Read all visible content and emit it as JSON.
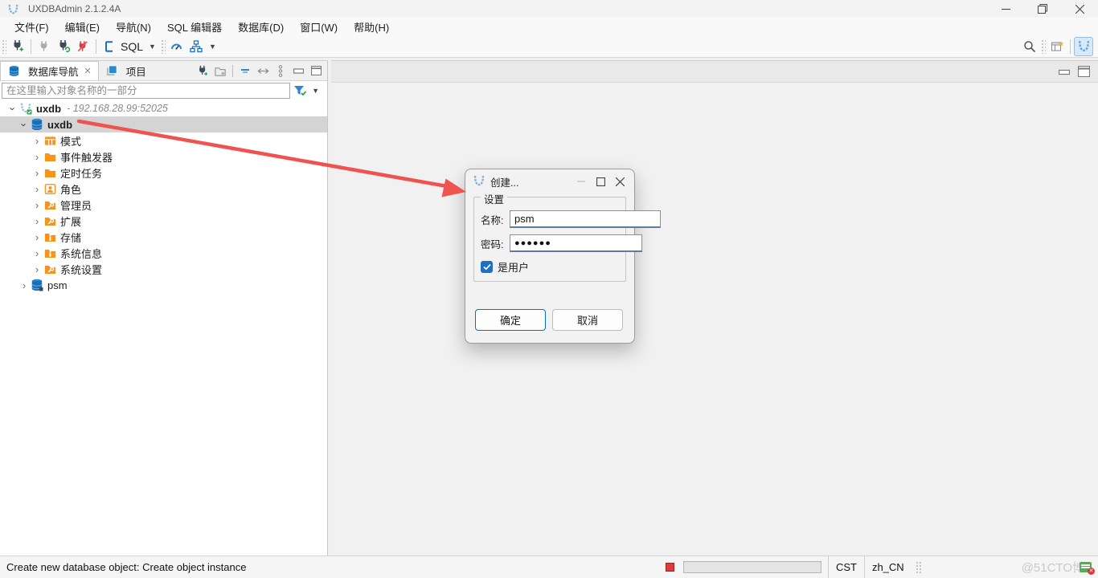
{
  "window": {
    "title": "UXDBAdmin 2.1.2.4A"
  },
  "menu": {
    "items": [
      "文件(F)",
      "编辑(E)",
      "导航(N)",
      "SQL 编辑器",
      "数据库(D)",
      "窗口(W)",
      "帮助(H)"
    ]
  },
  "toolbar": {
    "sql_label": "SQL"
  },
  "navigator": {
    "tab_database": "数据库导航",
    "tab_projects": "项目",
    "filter_placeholder": "在这里输入对象名称的一部分",
    "connection": {
      "name": "uxdb",
      "address": "- 192.168.28.99:52025"
    },
    "database": {
      "name": "uxdb"
    },
    "children": [
      {
        "label": "模式"
      },
      {
        "label": "事件触发器"
      },
      {
        "label": "定时任务"
      },
      {
        "label": "角色"
      },
      {
        "label": "管理员"
      },
      {
        "label": "扩展"
      },
      {
        "label": "存储"
      },
      {
        "label": "系统信息"
      },
      {
        "label": "系统设置"
      }
    ],
    "sibling_database": "psm"
  },
  "dialog": {
    "title": "创建...",
    "group_label": "设置",
    "name_label": "名称:",
    "name_value": "psm",
    "password_label": "密码:",
    "password_value": "●●●●●●",
    "checkbox_label": "是用户",
    "ok_label": "确定",
    "cancel_label": "取消"
  },
  "statusbar": {
    "message": "Create new database object:  Create object instance",
    "timezone": "CST",
    "locale": "zh_CN",
    "watermark": "@51CTO博"
  },
  "colors": {
    "accent_blue": "#0b6fc2",
    "folder_orange": "#f7941e",
    "database_blue": "#1b75c4",
    "arrow_red": "#ef5350",
    "logo_blue": "#7ab1e0"
  }
}
